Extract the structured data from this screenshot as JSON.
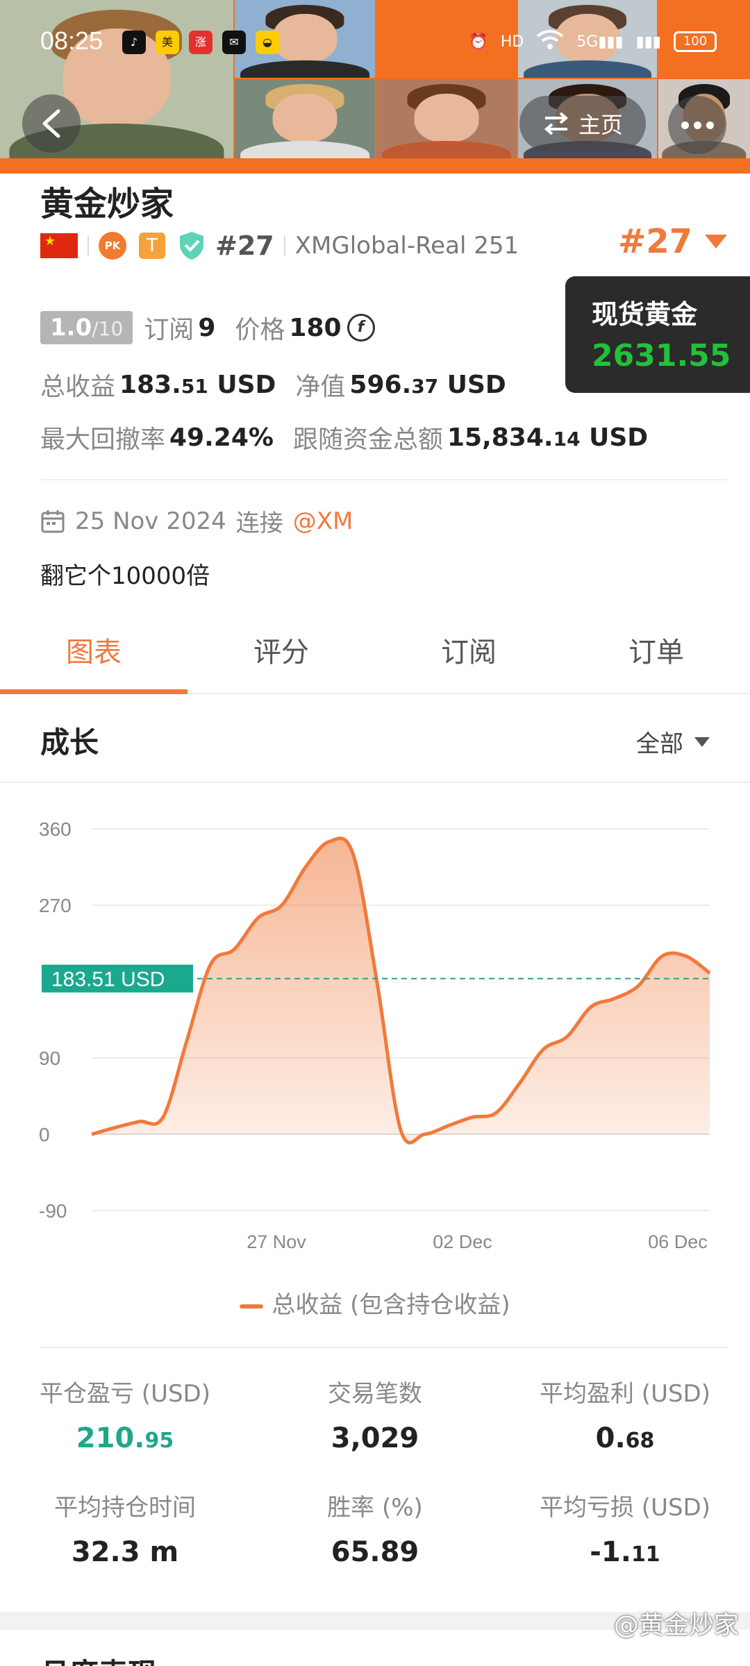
{
  "status_bar": {
    "time": "08:25",
    "battery": "100",
    "network": "5G"
  },
  "nav": {
    "home_label": "主页"
  },
  "trader": {
    "name": "黄金炒家",
    "rank": "#27",
    "account": "XMGlobal-Real 251",
    "rank_display": "#27"
  },
  "gold_ticker": {
    "name": "现货黄金",
    "price": "2631.55",
    "price_color": "#22c13a"
  },
  "stats": {
    "rating_value": "1.0",
    "rating_max": "/10",
    "subscribe_label": "订阅",
    "subscribe_count": "9",
    "price_label": "价格",
    "price_value": "180",
    "total_profit_label": "总收益",
    "total_profit_main": "183.",
    "total_profit_dec": "51",
    "total_profit_unit": "USD",
    "equity_label": "净值",
    "equity_main": "596.",
    "equity_dec": "37",
    "equity_unit": "USD",
    "drawdown_label": "最大回撤率",
    "drawdown_value": "49.24%",
    "follow_label": "跟随资金总额",
    "follow_main": "15,834.",
    "follow_dec": "14",
    "follow_unit": "USD"
  },
  "join": {
    "date": "25 Nov 2024",
    "text": "连接",
    "broker": "@XM"
  },
  "bio": "翻它个10000倍",
  "tabs": [
    {
      "label": "图表",
      "active": true
    },
    {
      "label": "评分",
      "active": false
    },
    {
      "label": "订阅",
      "active": false
    },
    {
      "label": "订单",
      "active": false
    }
  ],
  "section": {
    "title": "成长",
    "filter": "全部"
  },
  "chart_data": {
    "type": "area",
    "y_ticks": [
      "360",
      "270",
      "90",
      "0",
      "-90"
    ],
    "ylim": [
      -90,
      360
    ],
    "x_tick_labels": [
      "27 Nov",
      "02 Dec",
      "06 Dec"
    ],
    "current_label": "183.51 USD",
    "current_value": 183.51,
    "series": [
      {
        "name": "总收益 (包含持仓收益)",
        "color": "#f07a3c",
        "values": [
          0,
          8,
          15,
          20,
          110,
          200,
          218,
          255,
          270,
          315,
          345,
          330,
          180,
          5,
          0,
          10,
          20,
          25,
          60,
          100,
          115,
          150,
          160,
          175,
          210,
          210,
          190
        ]
      }
    ],
    "legend": "总收益 (包含持仓收益)",
    "grid": true
  },
  "summary": {
    "items": [
      {
        "label": "平仓盈亏 (USD)",
        "value_main": "210.",
        "value_dec": "95",
        "green": true
      },
      {
        "label": "交易笔数",
        "value_main": "3,029",
        "value_dec": "",
        "green": false
      },
      {
        "label": "平均盈利 (USD)",
        "value_main": "0.",
        "value_dec": "68",
        "green": false
      },
      {
        "label": "平均持仓时间",
        "value_main": "32.3 m",
        "value_dec": "",
        "green": false
      },
      {
        "label": "胜率 (%)",
        "value_main": "65.89",
        "value_dec": "",
        "green": false
      },
      {
        "label": "平均亏损 (USD)",
        "value_main": "-1.",
        "value_dec": "11",
        "green": false
      }
    ]
  },
  "next_section_title": "月度表现",
  "watermark": "@黄金炒家"
}
